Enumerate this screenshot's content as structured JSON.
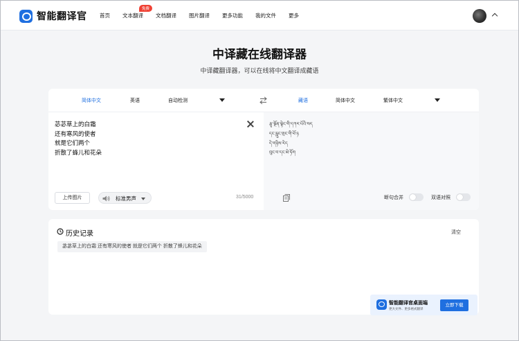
{
  "header": {
    "app_name": "智能翻译官",
    "nav": [
      {
        "label": "首页"
      },
      {
        "label": "文本翻译",
        "badge": "免费"
      },
      {
        "label": "文档翻译"
      },
      {
        "label": "图片翻译"
      },
      {
        "label": "更多功能"
      },
      {
        "label": "我的文件"
      },
      {
        "label": "更多"
      }
    ]
  },
  "hero": {
    "title": "中译藏在线翻译器",
    "subtitle": "中译藏翻译器，可以在线将中文翻译成藏语"
  },
  "translator": {
    "source_langs": [
      "简体中文",
      "英语",
      "自动检测"
    ],
    "target_langs": [
      "藏语",
      "简体中文",
      "繁体中文"
    ],
    "source_text": [
      "苾苾草上的白霜",
      "还有寒风的使者",
      "就是它们两个",
      "折散了蜂儿和花朵"
    ],
    "target_text": [
      "རྩྭ་སྔོན་སྟེང་གི་དཀར་པོའི་སད",
      "དང་རླུང་གྲང་གི་ཕོ་ཉ",
      "དེ་གཉིས་རེད",
      "བུང་བ་དང་མེ་ཏོག"
    ],
    "upload_label": "上传图片",
    "voice_label": "标准男声",
    "char_count": "31/5000",
    "toggle_merge_label": "断句合并",
    "toggle_bilingual_label": "双语对照"
  },
  "history": {
    "title": "历史记录",
    "clear_label": "清空",
    "items": [
      "苾苾草上的白霜 还有寒风的使者 就是它们两个 折散了蜂儿和花朵"
    ]
  },
  "promo": {
    "title": "智能翻译官桌面端",
    "subtitle": "更大文件、更多格式翻译",
    "button": "立即下载"
  },
  "colors": {
    "accent": "#1f6fe0",
    "badge": "#f04134",
    "page_bg": "#f4f5f7"
  }
}
